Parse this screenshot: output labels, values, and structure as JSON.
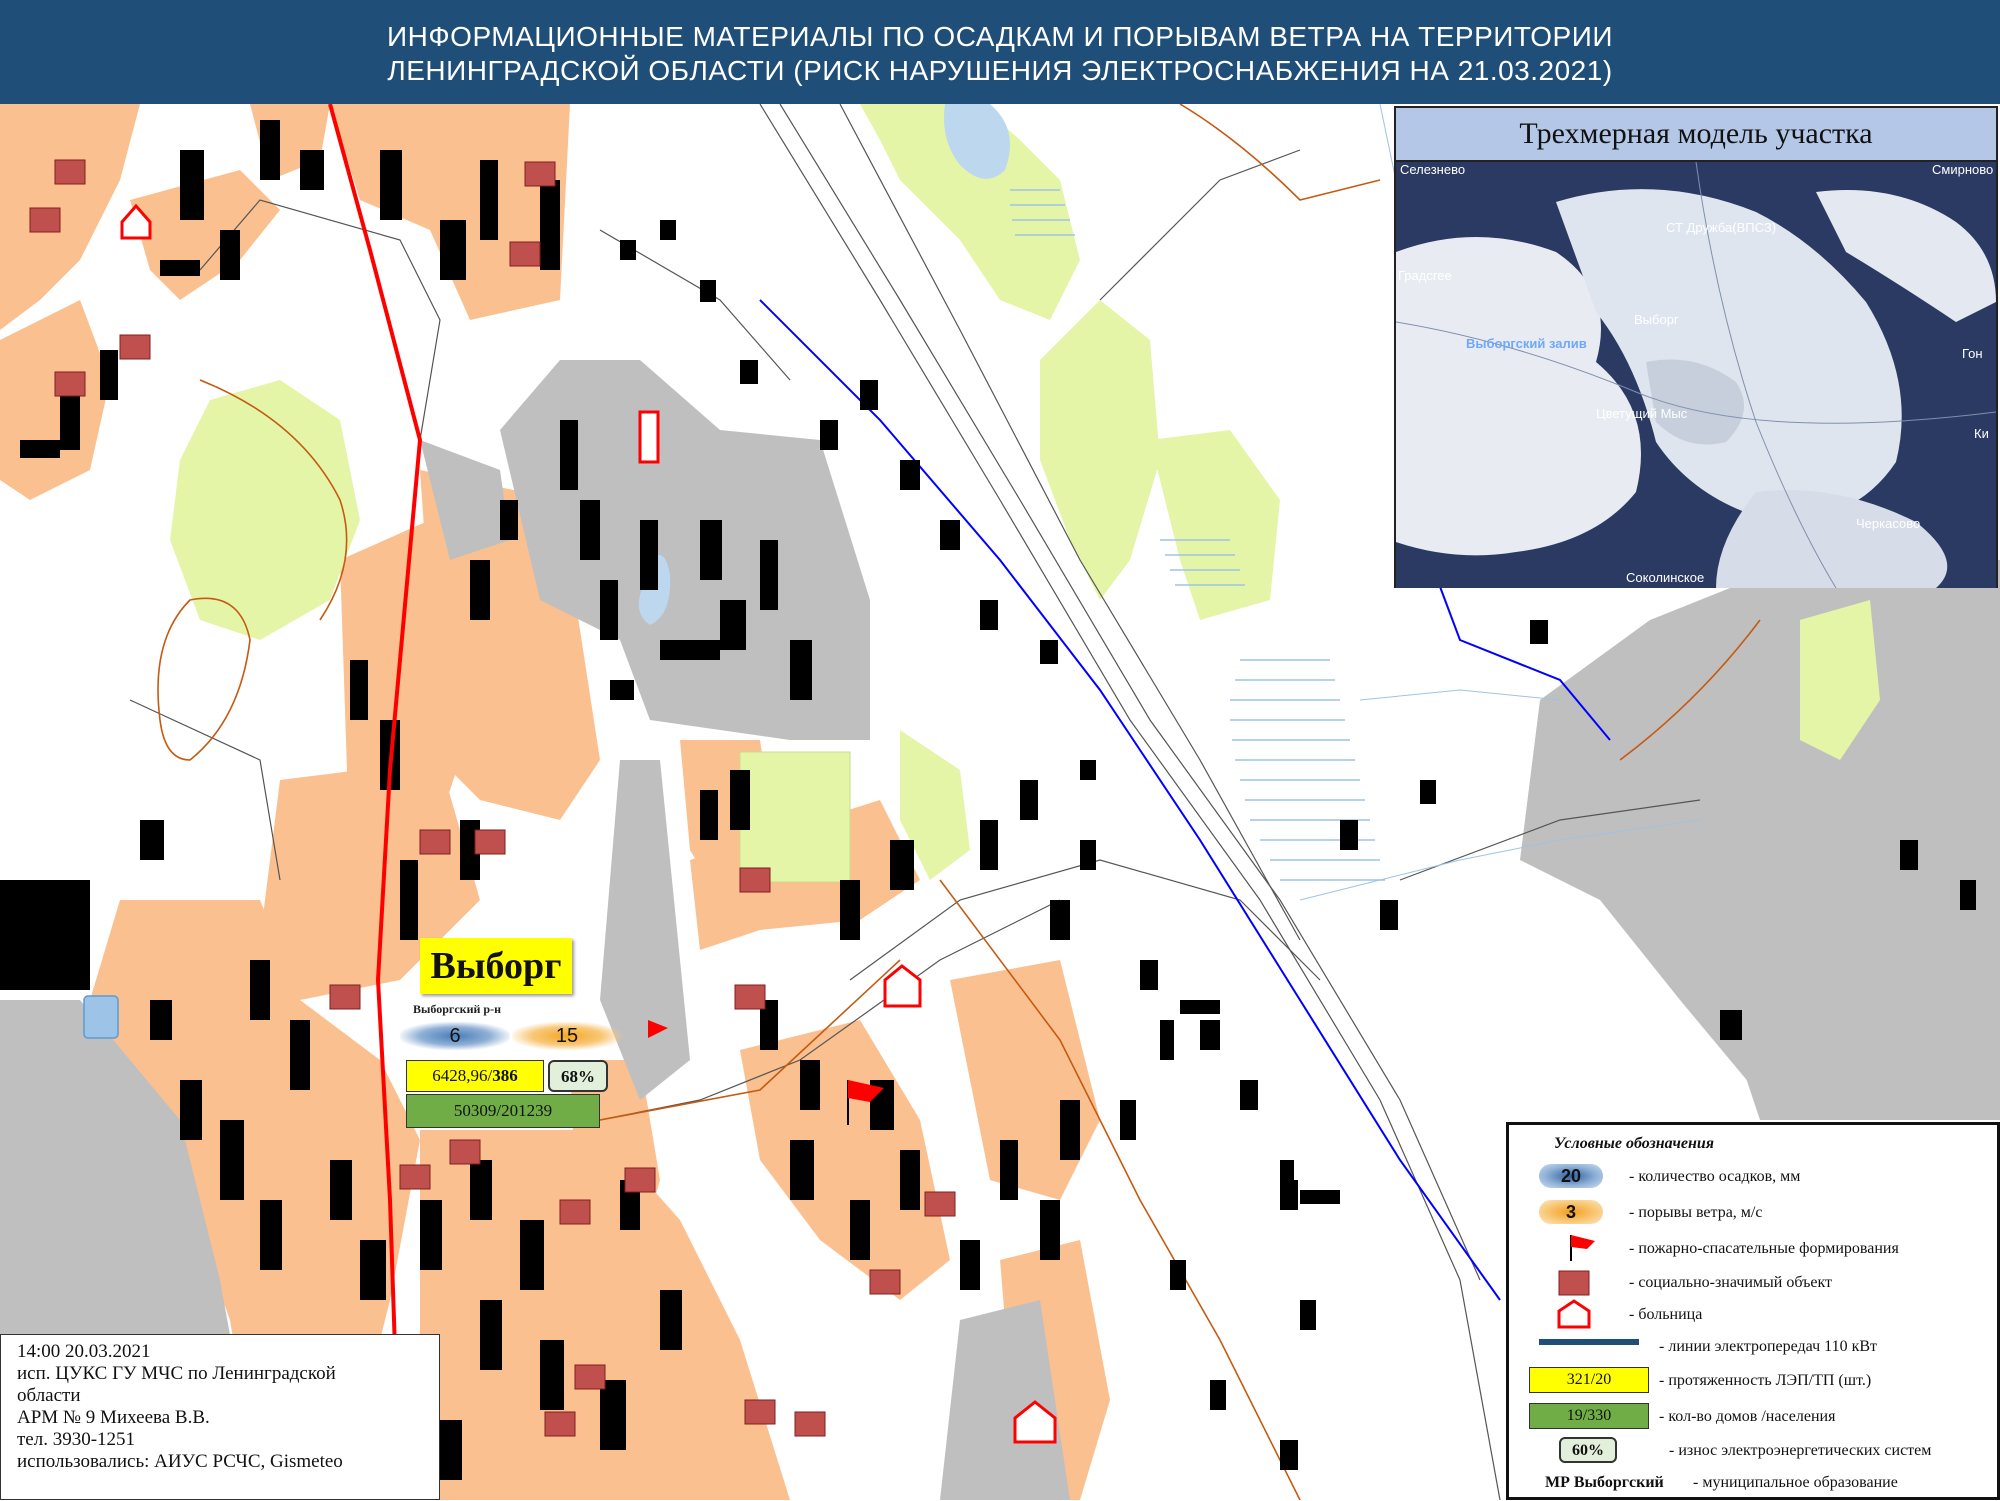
{
  "header": {
    "line1": "ИНФОРМАЦИОННЫЕ МАТЕРИАЛЫ ПО ОСАДКАМ И ПОРЫВАМ ВЕТРА НА ТЕРРИТОРИИ",
    "line2": "ЛЕНИНГРАДСКОЙ ОБЛАСТИ (РИСК НАРУШЕНИЯ ЭЛЕКТРОСНАБЖЕНИЯ НА 21.03.2021)"
  },
  "inset": {
    "caption": "Трехмерная модель участка",
    "places": [
      "Селезнево",
      "Смирново",
      "СТ Дружба(ВПСЗ)",
      "Градсгее",
      "Выборг",
      "Выборгский залив",
      "Гон",
      "Цветущий Мыс",
      "Ки",
      "Черкасово",
      "Соколинское"
    ]
  },
  "city": {
    "name": "Выборг",
    "district": "Выборгский р-н",
    "precipitation_mm": "6",
    "wind_gust_ms": "15",
    "lep_length": "6428,96",
    "tp_count": "386",
    "wear": "68%",
    "houses_population": "50309/201239"
  },
  "stamp": {
    "datetime": "14:00 20.03.2021",
    "executor_line1": "исп. ЦУКС ГУ МЧС по Ленинградской",
    "executor_line2": "области",
    "workstation": "АРМ № 9 Михеева В.В.",
    "phone": "тел. 3930-1251",
    "sources": "использовались: АИУС РСЧС, Gismeteo"
  },
  "legend": {
    "title": "Условные обозначения",
    "items": {
      "precip_sample": "20",
      "precip_text": "- количество осадков, мм",
      "gust_sample": "3",
      "gust_text": "- порывы ветра, м/с",
      "fire_text": "- пожарно-спасательные формирования",
      "social_text": "- социально-значимый объект",
      "hospital_text": "- больница",
      "powerline_text": "- линии электропередач 110 кВт",
      "lep_sample": "321/20",
      "lep_text": "- протяженность ЛЭП/ТП (шт.)",
      "houses_sample": "19/330",
      "houses_text": "- кол-во домов /населения",
      "wear_sample": "60%",
      "wear_text": "- износ электроэнергетических систем",
      "mo_sample": "МР Выборгский",
      "mo_text": "- муниципальное образование"
    }
  },
  "colors": {
    "header_bg": "#1f4e79",
    "residential": "#fbc08f",
    "industrial": "#bfbfbf",
    "park": "#e4f5a8",
    "powerline_110kv": "#ff0000",
    "precip_badge": "#4a7db8",
    "gust_badge": "#f5a623",
    "lep_box": "#ffff00",
    "houses_box": "#70ad47"
  }
}
